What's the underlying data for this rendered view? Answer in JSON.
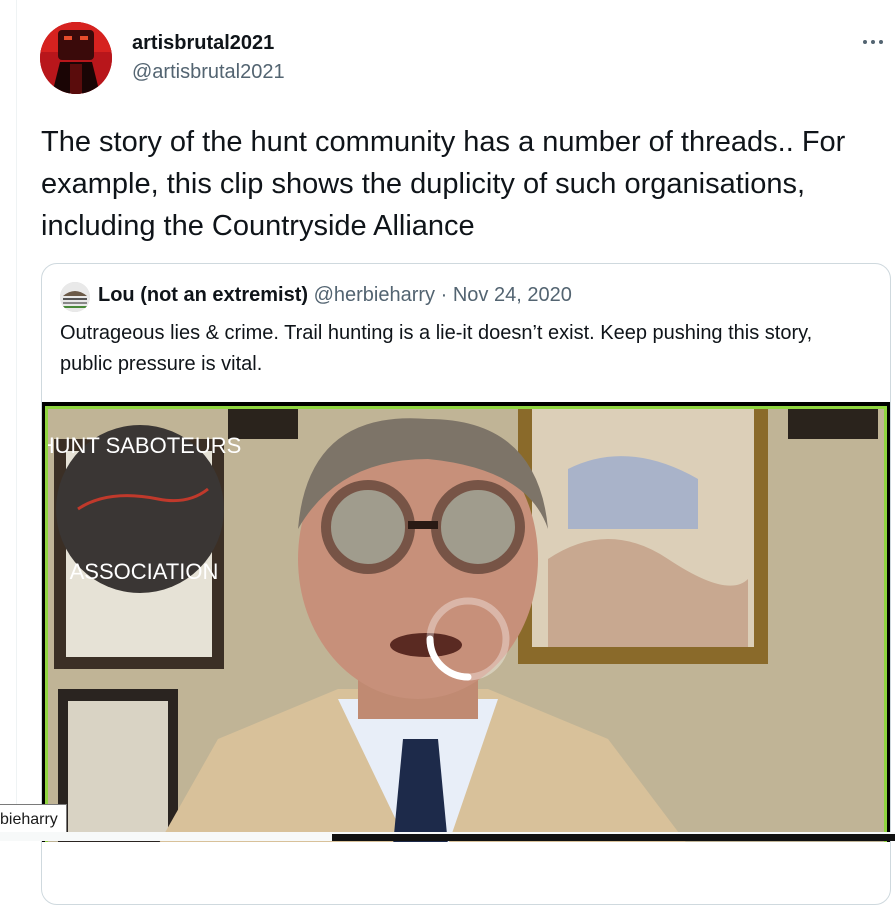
{
  "tweet": {
    "author": {
      "display_name": "artisbrutal2021",
      "handle": "@artisbrutal2021",
      "avatar_icon": "avatar-image"
    },
    "more_icon": "more-horizontal-icon",
    "text": "The story of the hunt community has a number of threads.. For example, this clip shows the duplicity of such organisations, including the Countryside Alliance"
  },
  "quoted_tweet": {
    "display_name": "Lou (not an extremist)",
    "handle": "@herbieharry",
    "separator": "·",
    "date": "Nov 24, 2020",
    "text": "Outrageous lies & crime. Trail hunting is a lie-it doesn’t exist. Keep pushing this story, public pressure is vital.",
    "video": {
      "watermark_top": "HUNT SABOTEURS",
      "watermark_bottom": "ASSOCIATION",
      "loading_icon": "loading-spinner-icon",
      "frame_color": "#8fd53f"
    }
  },
  "tooltip": {
    "text": "bieharry"
  },
  "colors": {
    "primary_text": "#0f1419",
    "secondary_text": "#536471",
    "border": "#cfd9de"
  }
}
